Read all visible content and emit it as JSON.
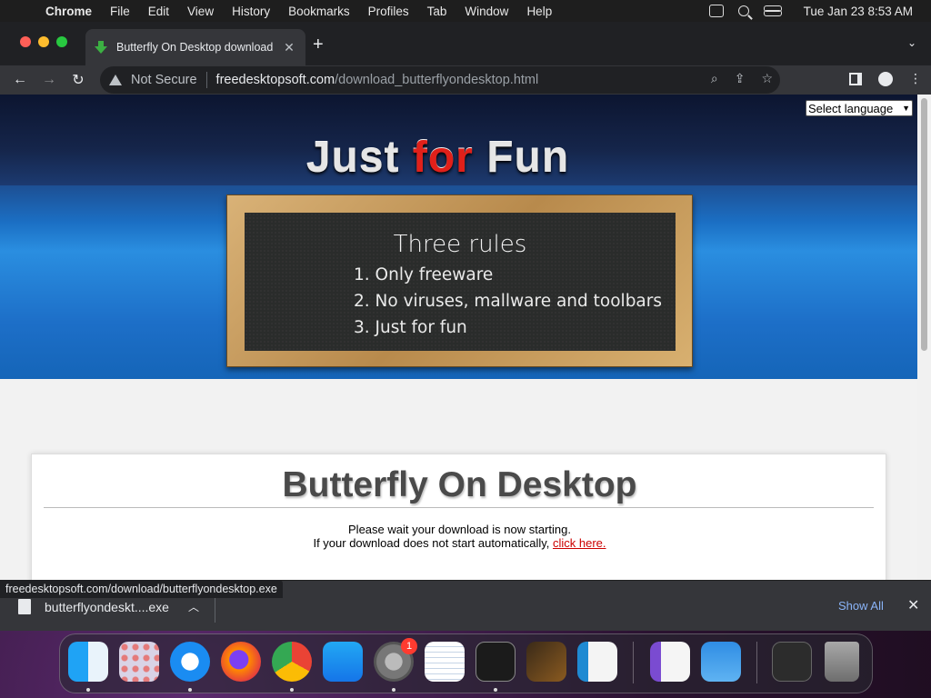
{
  "menubar": {
    "app": "Chrome",
    "items": [
      "File",
      "Edit",
      "View",
      "History",
      "Bookmarks",
      "Profiles",
      "Tab",
      "Window",
      "Help"
    ],
    "datetime": "Tue Jan 23  8:53 AM"
  },
  "browser": {
    "tab_title": "Butterfly On Desktop download",
    "security_label": "Not Secure",
    "url_host": "freedesktopsoft.com",
    "url_path": "/download_butterflyondesktop.html"
  },
  "page": {
    "language_select": "Select language",
    "logo": {
      "word1": "Just",
      "word2": "for",
      "word3": "Fun"
    },
    "board": {
      "title": "Three rules",
      "rules": [
        "1. Only freeware",
        "2. No viruses, mallware and toolbars",
        "3. Just for fun"
      ]
    },
    "heading": "Butterfly On Desktop",
    "message_line1": "Please wait your download is now starting.",
    "message_line2": "If your download does not start automatically,",
    "click_here": "click here."
  },
  "status_url": "freedesktopsoft.com/download/butterflyondesktop.exe",
  "download": {
    "filename": "butterflyondeskt....exe",
    "show_all": "Show All"
  },
  "dock": {
    "apps": [
      "finder-icon",
      "launchpad-icon",
      "safari-icon",
      "firefox-icon",
      "chrome-icon",
      "app-store-icon",
      "system-settings-icon",
      "textedit-icon",
      "terminal-icon",
      "garageband-icon",
      "vscode-icon",
      "visual-studio-icon",
      "weather-icon",
      "downloads-stack-icon",
      "trash-icon"
    ],
    "settings_badge": "1"
  }
}
